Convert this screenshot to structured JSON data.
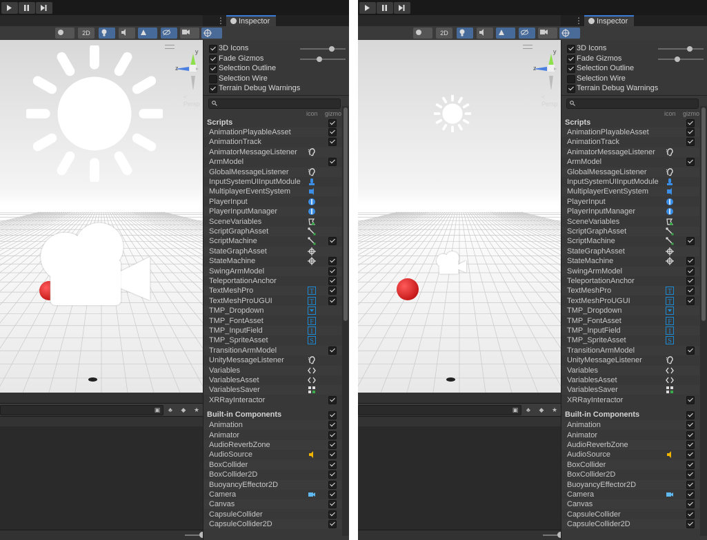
{
  "toolbar": {
    "mode_2d": "2D",
    "inspector_tab": "Inspector",
    "more_dots": "⋮"
  },
  "scene": {
    "persp_label": "< Persp",
    "axis_y": "y",
    "axis_z": "z"
  },
  "gizmo_options": [
    {
      "label": "3D Icons",
      "checked": true,
      "has_slider": true,
      "slider_value": 0.7
    },
    {
      "label": "Fade Gizmos",
      "checked": true,
      "has_slider": true,
      "slider_value": 0.4
    },
    {
      "label": "Selection Outline",
      "checked": true
    },
    {
      "label": "Selection Wire",
      "checked": false
    },
    {
      "label": "Terrain Debug Warnings",
      "checked": true
    }
  ],
  "columns": {
    "icon": "icon",
    "gizmo": "gizmo"
  },
  "scripts_section": {
    "label": "Scripts",
    "checked": true
  },
  "scripts": [
    {
      "name": "AnimationPlayableAsset",
      "icon": "",
      "gizmo": true
    },
    {
      "name": "AnimationTrack",
      "icon": "",
      "gizmo": true
    },
    {
      "name": "AnimatorMessageListener",
      "icon": "ear-icon",
      "gizmo": false
    },
    {
      "name": "ArmModel",
      "icon": "",
      "gizmo": true
    },
    {
      "name": "GlobalMessageListener",
      "icon": "ear-icon",
      "gizmo": false
    },
    {
      "name": "InputSystemUIInputModule",
      "icon": "input-module-icon",
      "gizmo": false
    },
    {
      "name": "MultiplayerEventSystem",
      "icon": "event-system-icon",
      "gizmo": false
    },
    {
      "name": "PlayerInput",
      "icon": "player-input-icon",
      "gizmo": false
    },
    {
      "name": "PlayerInputManager",
      "icon": "player-input-icon",
      "gizmo": false
    },
    {
      "name": "SceneVariables",
      "icon": "variables-icon",
      "gizmo": false
    },
    {
      "name": "ScriptGraphAsset",
      "icon": "graph-icon",
      "gizmo": false
    },
    {
      "name": "ScriptMachine",
      "icon": "graph-icon",
      "gizmo": true
    },
    {
      "name": "StateGraphAsset",
      "icon": "state-icon",
      "gizmo": false
    },
    {
      "name": "StateMachine",
      "icon": "state-icon",
      "gizmo": true
    },
    {
      "name": "SwingArmModel",
      "icon": "",
      "gizmo": true
    },
    {
      "name": "TeleportationAnchor",
      "icon": "",
      "gizmo": true
    },
    {
      "name": "TextMeshPro",
      "icon": "tmp-text-icon",
      "gizmo": true
    },
    {
      "name": "TextMeshProUGUI",
      "icon": "tmp-text-icon",
      "gizmo": true
    },
    {
      "name": "TMP_Dropdown",
      "icon": "tmp-dropdown-icon",
      "gizmo": false
    },
    {
      "name": "TMP_FontAsset",
      "icon": "tmp-font-icon",
      "gizmo": false
    },
    {
      "name": "TMP_InputField",
      "icon": "tmp-input-icon",
      "gizmo": false
    },
    {
      "name": "TMP_SpriteAsset",
      "icon": "tmp-sprite-icon",
      "gizmo": false
    },
    {
      "name": "TransitionArmModel",
      "icon": "",
      "gizmo": true
    },
    {
      "name": "UnityMessageListener",
      "icon": "ear-icon",
      "gizmo": false
    },
    {
      "name": "Variables",
      "icon": "code-icon",
      "gizmo": false
    },
    {
      "name": "VariablesAsset",
      "icon": "code-icon",
      "gizmo": false
    },
    {
      "name": "VariablesSaver",
      "icon": "saver-icon",
      "gizmo": false
    },
    {
      "name": "XRRayInteractor",
      "icon": "",
      "gizmo": true
    }
  ],
  "builtin_section": {
    "label": "Built-in Components",
    "checked": true
  },
  "builtin": [
    {
      "name": "Animation",
      "icon": "",
      "gizmo": true
    },
    {
      "name": "Animator",
      "icon": "",
      "gizmo": true
    },
    {
      "name": "AudioReverbZone",
      "icon": "",
      "gizmo": true
    },
    {
      "name": "AudioSource",
      "icon": "speaker-icon",
      "gizmo": true
    },
    {
      "name": "BoxCollider",
      "icon": "",
      "gizmo": true
    },
    {
      "name": "BoxCollider2D",
      "icon": "",
      "gizmo": true
    },
    {
      "name": "BuoyancyEffector2D",
      "icon": "",
      "gizmo": true
    },
    {
      "name": "Camera",
      "icon": "camera-icon",
      "gizmo": true
    },
    {
      "name": "Canvas",
      "icon": "",
      "gizmo": true
    },
    {
      "name": "CapsuleCollider",
      "icon": "",
      "gizmo": true
    },
    {
      "name": "CapsuleCollider2D",
      "icon": "",
      "gizmo": true
    }
  ],
  "colors": {
    "accent_blue": "#3a7cd8",
    "tmp_blue": "#1a8cd8",
    "panel_bg": "#383838",
    "speaker": "#f0b400",
    "camera_icon": "#5fb8f0"
  }
}
